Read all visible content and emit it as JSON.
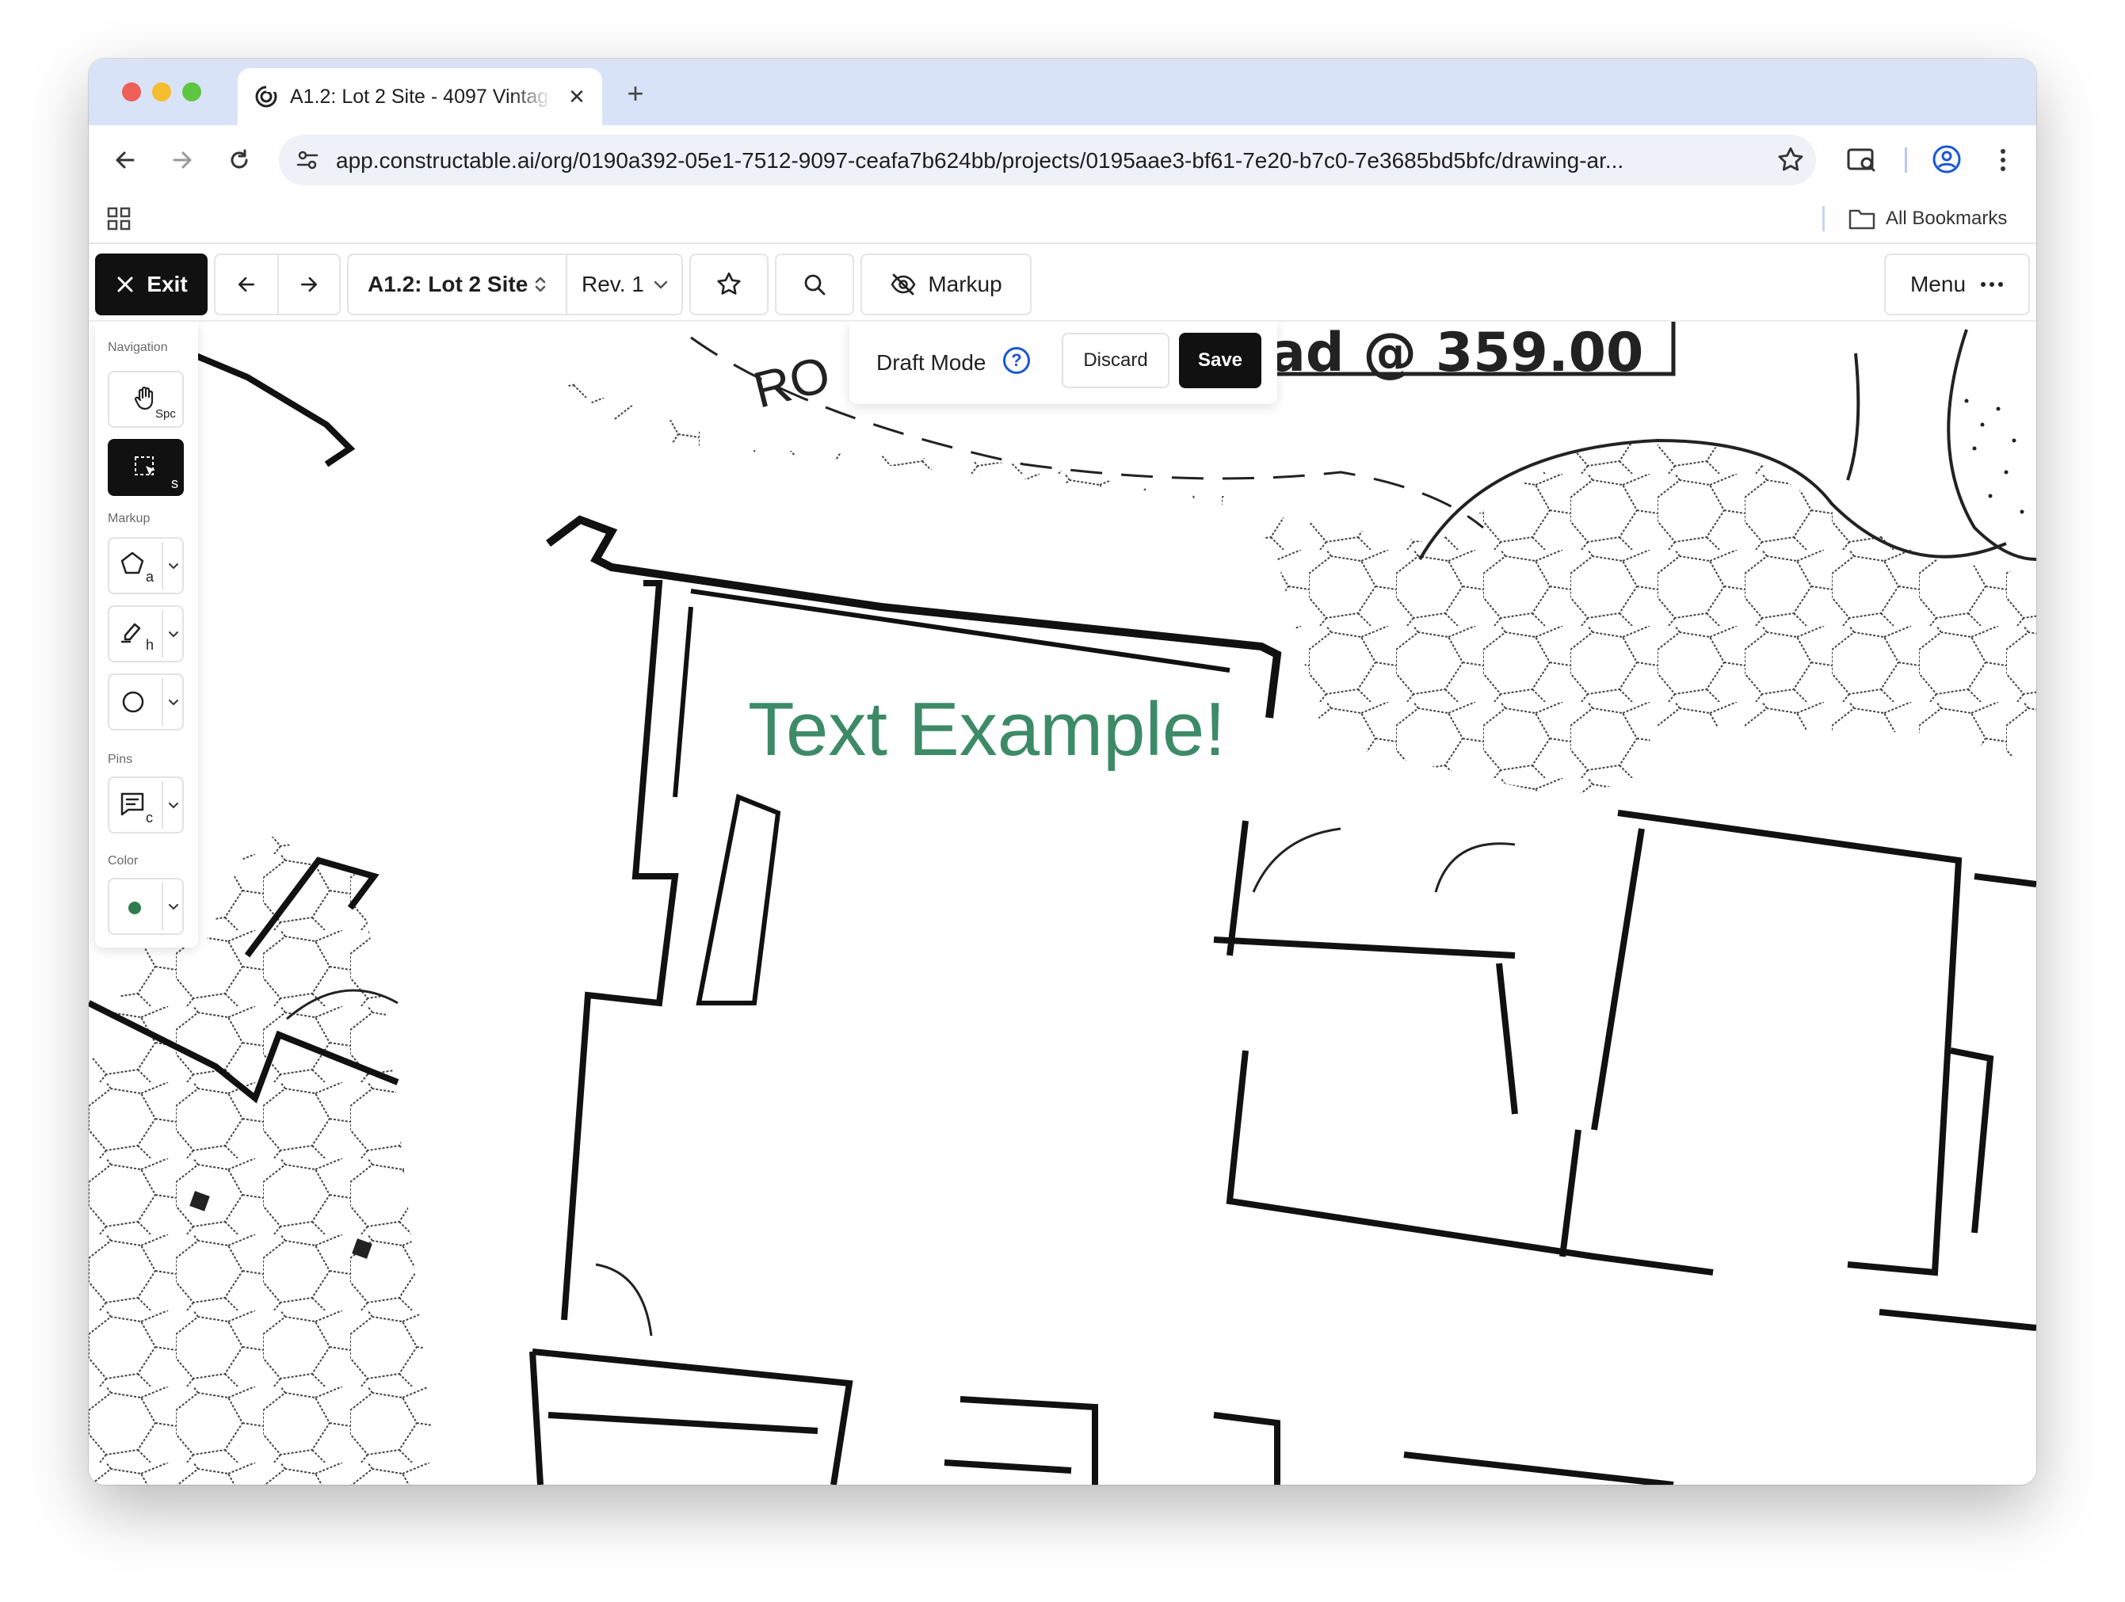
{
  "browser": {
    "tab_title": "A1.2: Lot 2 Site - 4097 Vintage",
    "tab_close": "✕",
    "new_tab": "+",
    "url": "app.constructable.ai/org/0190a392-05e1-7512-9097-ceafa7b624bb/projects/0195aae3-bf61-7e20-b7c0-7e3685bd5bfc/drawing-ar...",
    "bookmarks_label": "All Bookmarks"
  },
  "toolbar": {
    "exit_label": "Exit",
    "sheet_name": "A1.2: Lot 2 Site",
    "revision": "Rev. 1",
    "markup_label": "Markup",
    "menu_label": "Menu"
  },
  "draft": {
    "mode_label": "Draft Mode",
    "help": "?",
    "discard_label": "Discard",
    "save_label": "Save"
  },
  "sidebar": {
    "navigation_label": "Navigation",
    "pan_key": "Spc",
    "select_key": "s",
    "markup_label": "Markup",
    "polygon_key": "a",
    "highlight_key": "h",
    "pins_label": "Pins",
    "pin_key": "c",
    "color_label": "Color",
    "current_color": "#2e7d4f"
  },
  "drawing": {
    "text_markup": "Text Example!",
    "road_label_fragment": "ad @ 359.00",
    "road_label_left": "RO",
    "markup_color": "#3d8a67"
  },
  "colors": {
    "accent_dark": "#111111",
    "tab_strip": "#d9e3f7",
    "help_blue": "#1a56d6"
  }
}
